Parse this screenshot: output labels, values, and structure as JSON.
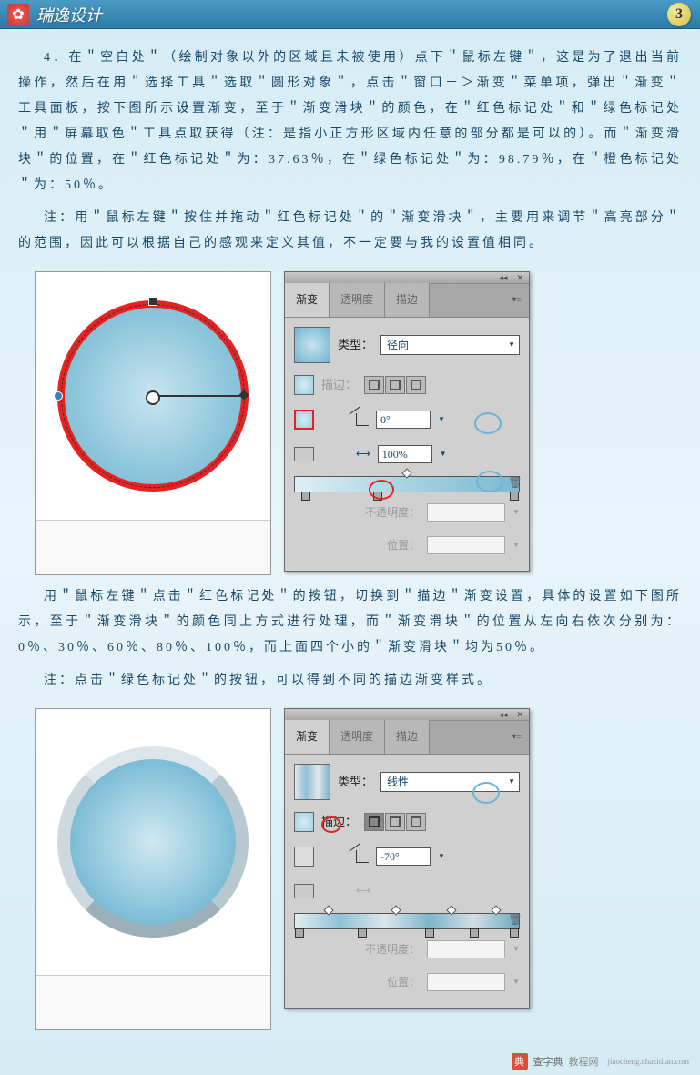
{
  "header": {
    "title": "瑞逸设计",
    "page_number": "3"
  },
  "paragraphs": {
    "p1": "4．在＂空白处＂（绘制对象以外的区域且未被使用）点下＂鼠标左键＂，这是为了退出当前操作，然后在用＂选择工具＂选取＂圆形对象＂，点击＂窗口－＞渐变＂菜单项，弹出＂渐变＂工具面板，按下图所示设置渐变，至于＂渐变滑块＂的颜色，在＂红色标记处＂和＂绿色标记处＂用＂屏幕取色＂工具点取获得（注：是指小正方形区域内任意的部分都是可以的）。而＂渐变滑块＂的位置，在＂红色标记处＂为：37.63％，在＂绿色标记处＂为：98.79％，在＂橙色标记处＂为：50％。",
    "p2": "注：用＂鼠标左键＂按住并拖动＂红色标记处＂的＂渐变滑块＂，主要用来调节＂高亮部分＂的范围，因此可以根据自己的感观来定义其值，不一定要与我的设置值相同。",
    "p3": "用＂鼠标左键＂点击＂红色标记处＂的按钮，切换到＂描边＂渐变设置，具体的设置如下图所示，至于＂渐变滑块＂的颜色同上方式进行处理，而＂渐变滑块＂的位置从左向右依次分别为：0％、30％、60％、80％、100％，而上面四个小的＂渐变滑块＂均为50％。",
    "p4": "注：点击＂绿色标记处＂的按钮，可以得到不同的描边渐变样式。"
  },
  "panel1": {
    "tabs": [
      "渐变",
      "透明度",
      "描边"
    ],
    "active_tab": 0,
    "type_label": "类型：",
    "type_value": "径向",
    "stroke_label": "描边：",
    "angle_value": "0°",
    "scale_value": "100%",
    "opacity_label": "不透明度：",
    "position_label": "位置："
  },
  "panel2": {
    "tabs": [
      "渐变",
      "透明度",
      "描边"
    ],
    "active_tab": 0,
    "type_label": "类型：",
    "type_value": "线性",
    "stroke_label": "描边：",
    "angle_value": "-70°",
    "opacity_label": "不透明度：",
    "position_label": "位置："
  },
  "footer": {
    "site_name": "查字典",
    "site_suffix": "教程网",
    "url": "jiaocheng.chazidian.com"
  },
  "chart_data": {
    "type": "table",
    "title": "渐变滑块位置值",
    "figure1_stops": [
      {
        "marker": "红色标记处",
        "position_pct": 37.63
      },
      {
        "marker": "绿色标记处",
        "position_pct": 98.79
      },
      {
        "marker": "橙色标记处",
        "position_pct": 50
      }
    ],
    "figure2_bottom_stops_pct": [
      0,
      30,
      60,
      80,
      100
    ],
    "figure2_top_stops_pct": [
      50,
      50,
      50,
      50
    ]
  }
}
